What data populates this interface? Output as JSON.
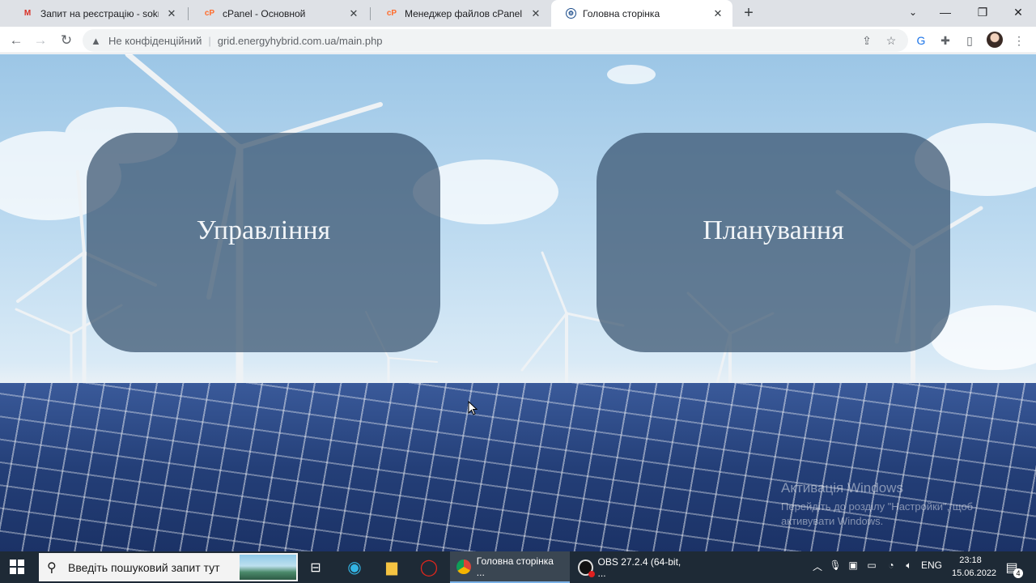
{
  "browser": {
    "tabs": [
      {
        "favicon": "gmail-icon",
        "title": "Запит на реєстрацію - sokrutan"
      },
      {
        "favicon": "cpanel-icon",
        "title": "cPanel - Основной"
      },
      {
        "favicon": "cpanel-icon",
        "title": "Менеджер файлов cPanel верс"
      },
      {
        "favicon": "site-icon",
        "title": "Головна сторінка"
      }
    ],
    "active_tab": 3,
    "address": {
      "security_label": "Не конфіденційний",
      "url": "grid.energyhybrid.com.ua/main.php"
    }
  },
  "page": {
    "cards": [
      {
        "label": "Управління"
      },
      {
        "label": "Планування"
      }
    ],
    "watermark": {
      "title": "Активація Windows",
      "line1": "Перейдіть до розділу \"Настройки\", щоб",
      "line2": "активувати Windows."
    }
  },
  "taskbar": {
    "search_placeholder": "Введіть пошуковий запит тут",
    "windows": [
      {
        "icon": "chrome-icon",
        "label": "Головна сторінка ..."
      },
      {
        "icon": "obs-icon",
        "label": "OBS 27.2.4 (64-bit, ..."
      }
    ],
    "language": "ENG",
    "time": "23:18",
    "date": "15.06.2022",
    "notification_count": "4"
  }
}
